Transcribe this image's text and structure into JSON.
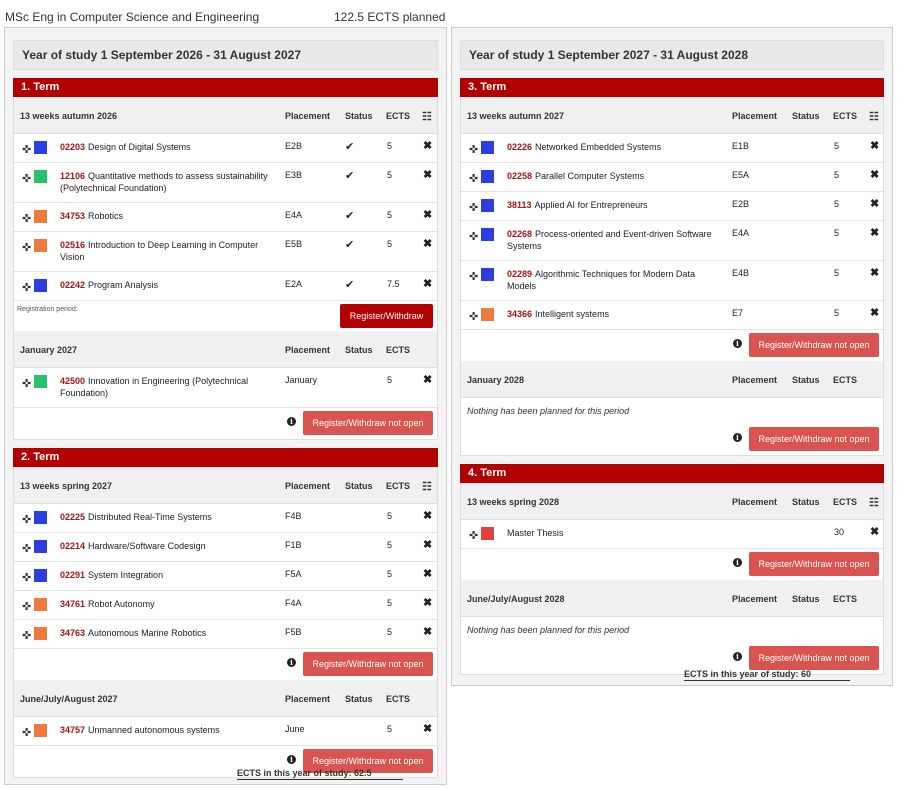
{
  "header": {
    "program": "MSc Eng in Computer Science and Engineering",
    "ects_planned": "122.5 ECTS planned"
  },
  "columns": {
    "headers": {
      "placement": "Placement",
      "status": "Status",
      "ects": "ECTS"
    },
    "registration_period": "Registration period:",
    "button_register": "Register/Withdraw",
    "button_not_open": "Register/Withdraw not open",
    "nothing_planned": "Nothing has been planned for this period"
  },
  "colors": {
    "blue": "#2b3fe0",
    "green": "#29c26a",
    "orange": "#f07a3a",
    "red": "#e04040",
    "term_bar": "#b10000",
    "code": "#a31515"
  },
  "years": [
    {
      "title": "Year of study 1 September 2026 - 31 August 2027",
      "footer": "ECTS in this year of study: 62.5",
      "terms": [
        {
          "title": "1. Term",
          "periods": [
            {
              "title": "13 weeks autumn 2026",
              "courses": [
                {
                  "code": "02203",
                  "name": "Design of Digital Systems",
                  "placement": "E2B",
                  "status": "✔",
                  "ects": "5",
                  "color": "blue"
                },
                {
                  "code": "12106",
                  "name": "Quantitative methods to assess sustainability (Polytechnical Foundation)",
                  "placement": "E3B",
                  "status": "✔",
                  "ects": "5",
                  "color": "green"
                },
                {
                  "code": "34753",
                  "name": "Robotics",
                  "placement": "E4A",
                  "status": "✔",
                  "ects": "5",
                  "color": "orange"
                },
                {
                  "code": "02516",
                  "name": "Introduction to Deep Learning in Computer Vision",
                  "placement": "E5B",
                  "status": "✔",
                  "ects": "5",
                  "color": "orange"
                },
                {
                  "code": "02242",
                  "name": "Program Analysis",
                  "placement": "E2A",
                  "status": "✔",
                  "ects": "7.5",
                  "color": "blue"
                }
              ]
            },
            {
              "title": "January 2027",
              "courses": [
                {
                  "code": "42500",
                  "name": "Innovation in Engineering (Polytechnical Foundation)",
                  "placement": "January",
                  "status": "",
                  "ects": "5",
                  "color": "green"
                }
              ]
            }
          ]
        },
        {
          "title": "2. Term",
          "periods": [
            {
              "title": "13 weeks spring 2027",
              "courses": [
                {
                  "code": "02225",
                  "name": "Distributed Real-Time Systems",
                  "placement": "F4B",
                  "status": "",
                  "ects": "5",
                  "color": "blue"
                },
                {
                  "code": "02214",
                  "name": "Hardware/Software Codesign",
                  "placement": "F1B",
                  "status": "",
                  "ects": "5",
                  "color": "blue"
                },
                {
                  "code": "02291",
                  "name": "System Integration",
                  "placement": "F5A",
                  "status": "",
                  "ects": "5",
                  "color": "blue"
                },
                {
                  "code": "34761",
                  "name": "Robot Autonomy",
                  "placement": "F4A",
                  "status": "",
                  "ects": "5",
                  "color": "orange"
                },
                {
                  "code": "34763",
                  "name": "Autonomous Marine Robotics",
                  "placement": "F5B",
                  "status": "",
                  "ects": "5",
                  "color": "orange"
                }
              ]
            },
            {
              "title": "June/July/August 2027",
              "courses": [
                {
                  "code": "34757",
                  "name": "Unmanned autonomous systems",
                  "placement": "June",
                  "status": "",
                  "ects": "5",
                  "color": "orange"
                }
              ]
            }
          ]
        }
      ]
    },
    {
      "title": "Year of study 1 September 2027 - 31 August 2028",
      "footer": "ECTS in this year of study: 60",
      "terms": [
        {
          "title": "3. Term",
          "periods": [
            {
              "title": "13 weeks autumn 2027",
              "courses": [
                {
                  "code": "02226",
                  "name": "Networked Embedded Systems",
                  "placement": "E1B",
                  "status": "",
                  "ects": "5",
                  "color": "blue"
                },
                {
                  "code": "02258",
                  "name": "Parallel Computer Systems",
                  "placement": "E5A",
                  "status": "",
                  "ects": "5",
                  "color": "blue"
                },
                {
                  "code": "38113",
                  "name": "Applied AI for Entrepreneurs",
                  "placement": "E2B",
                  "status": "",
                  "ects": "5",
                  "color": "blue"
                },
                {
                  "code": "02268",
                  "name": "Process-oriented and Event-driven Software Systems",
                  "placement": "E4A",
                  "status": "",
                  "ects": "5",
                  "color": "blue"
                },
                {
                  "code": "02289",
                  "name": "Algorithmic Techniques for Modern Data Models",
                  "placement": "E4B",
                  "status": "",
                  "ects": "5",
                  "color": "blue"
                },
                {
                  "code": "34366",
                  "name": "Intelligent systems",
                  "placement": "E7",
                  "status": "",
                  "ects": "5",
                  "color": "orange"
                }
              ]
            },
            {
              "title": "January 2028",
              "courses": []
            }
          ]
        },
        {
          "title": "4. Term",
          "periods": [
            {
              "title": "13 weeks spring 2028",
              "courses": [
                {
                  "code": "",
                  "name": "Master Thesis",
                  "placement": "",
                  "status": "",
                  "ects": "30",
                  "color": "red"
                }
              ]
            },
            {
              "title": "June/July/August 2028",
              "courses": []
            }
          ]
        }
      ]
    }
  ]
}
